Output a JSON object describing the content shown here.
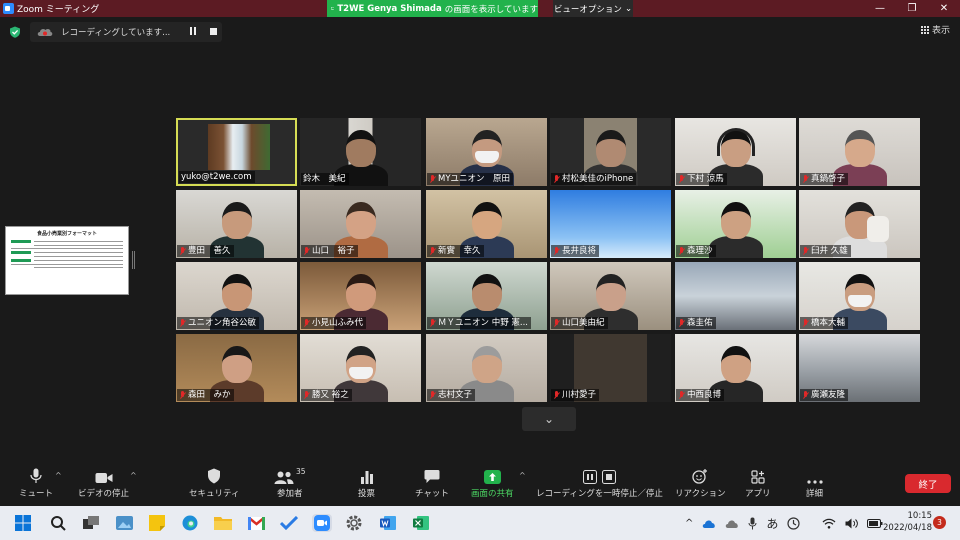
{
  "window": {
    "title": "Zoom ミーティング"
  },
  "share_banner": {
    "name": "T2WE Genya Shimada",
    "text": "の画面を表示しています"
  },
  "view_options": {
    "label": "ビューオプション"
  },
  "recording": {
    "status": "レコーディングしています..."
  },
  "view_button": {
    "label": "表示"
  },
  "shared_doc": {
    "title": "食品小売業別フォーマット"
  },
  "participants": [
    {
      "name": "yuko@t2we.com",
      "muted": false,
      "active": true
    },
    {
      "name": "鈴木　美紀",
      "muted": false
    },
    {
      "name": "MYユニオン　原田",
      "muted": true
    },
    {
      "name": "村松美佳のiPhone",
      "muted": true
    },
    {
      "name": "下村 涼馬",
      "muted": true
    },
    {
      "name": "真鍋啓子",
      "muted": true
    },
    {
      "name": "豊田　善久",
      "muted": true
    },
    {
      "name": "山口　裕子",
      "muted": true
    },
    {
      "name": "新實　幸久",
      "muted": true
    },
    {
      "name": "長井良将",
      "muted": true
    },
    {
      "name": "森理沙",
      "muted": true
    },
    {
      "name": "臼井 久雄",
      "muted": true
    },
    {
      "name": "ユニオン角谷公敏",
      "muted": true
    },
    {
      "name": "小見山ふみ代",
      "muted": true
    },
    {
      "name": "ＭＹユニオン 中野 憲...",
      "muted": true
    },
    {
      "name": "山口美由紀",
      "muted": true
    },
    {
      "name": "森圭佑",
      "muted": true
    },
    {
      "name": "橋本大輔",
      "muted": true
    },
    {
      "name": "森田　みか",
      "muted": true
    },
    {
      "name": "勝又 裕之",
      "muted": true
    },
    {
      "name": "志村文子",
      "muted": true
    },
    {
      "name": "川村愛子",
      "muted": true
    },
    {
      "name": "中西良博",
      "muted": true
    },
    {
      "name": "廣瀬友隆",
      "muted": true
    }
  ],
  "toolbar": {
    "mute": "ミュート",
    "video": "ビデオの停止",
    "security": "セキュリティ",
    "participants": "参加者",
    "participants_count": "35",
    "poll": "投票",
    "chat": "チャット",
    "share": "画面の共有",
    "recording": "レコーディングを一時停止／停止",
    "reactions": "リアクション",
    "apps": "アプリ",
    "more": "詳細",
    "end": "終了"
  },
  "taskbar": {
    "time": "10:15",
    "date": "2022/04/18",
    "ime": "あ",
    "notifications": "3"
  },
  "colors": {
    "titlebar": "#5c1b23",
    "share_green": "#22b24c",
    "end_red": "#d9292e",
    "active_border": "#d5dc54",
    "muted_red": "#e02828"
  }
}
